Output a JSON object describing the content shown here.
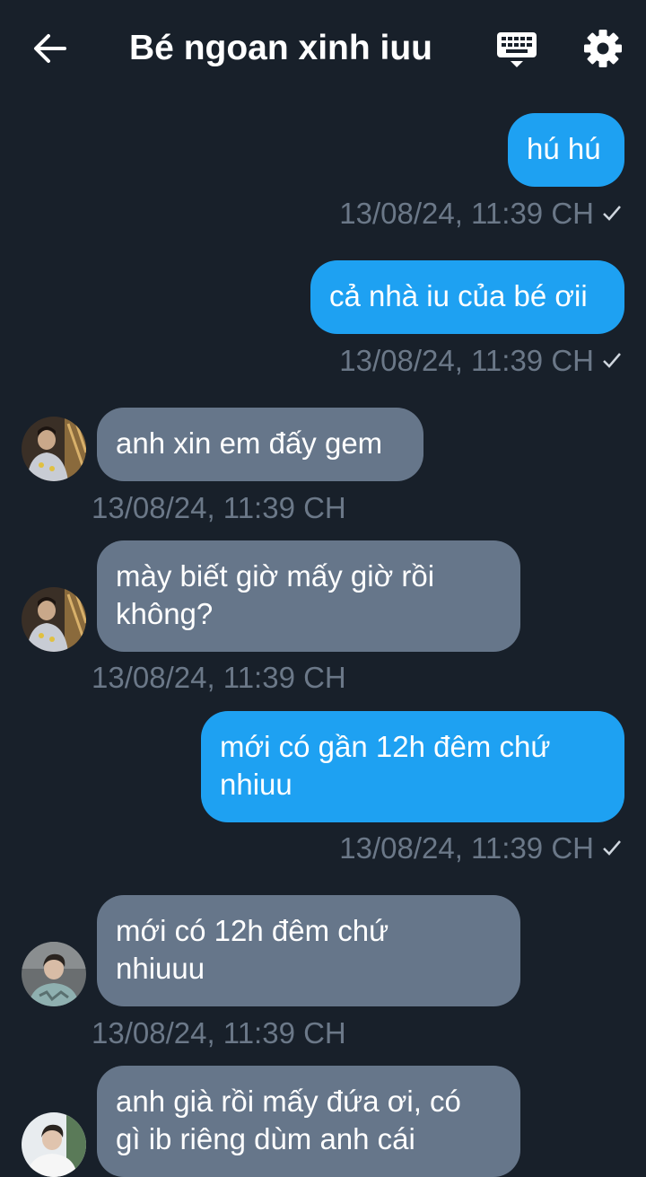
{
  "header": {
    "title": "Bé ngoan xinh iuu",
    "back_icon": "arrow-left-icon",
    "keyboard_icon": "keyboard-icon",
    "settings_icon": "gear-icon"
  },
  "messages": [
    {
      "direction": "outgoing",
      "text": "hú hú",
      "time": "13/08/24, 11:39 CH",
      "status": "sent"
    },
    {
      "direction": "outgoing",
      "text": "cả nhà iu của bé ơii",
      "time": "13/08/24, 11:39 CH",
      "status": "sent"
    },
    {
      "direction": "incoming",
      "lines": [
        "anh xin em đấy gem"
      ],
      "time": "13/08/24, 11:39 CH"
    },
    {
      "direction": "incoming",
      "lines": [
        "mày biết giờ mấy giờ rồi",
        "không?"
      ],
      "time": "13/08/24, 11:39 CH"
    },
    {
      "direction": "outgoing",
      "lines": [
        "mới có gần 12h đêm chứ",
        "nhiuu"
      ],
      "time": "13/08/24, 11:39 CH",
      "status": "sent"
    },
    {
      "direction": "incoming",
      "lines": [
        "mới có 12h đêm chứ",
        "nhiuuu"
      ],
      "time": "13/08/24, 11:39 CH"
    },
    {
      "direction": "incoming",
      "lines": [
        "anh già rồi mấy đứa ơi, có",
        "gì ib riêng dùm anh cái"
      ]
    }
  ],
  "colors": {
    "background": "#18202a",
    "outgoing_bubble": "#1ea1f2",
    "incoming_bubble": "#66768a",
    "timestamp": "#6b7888"
  }
}
